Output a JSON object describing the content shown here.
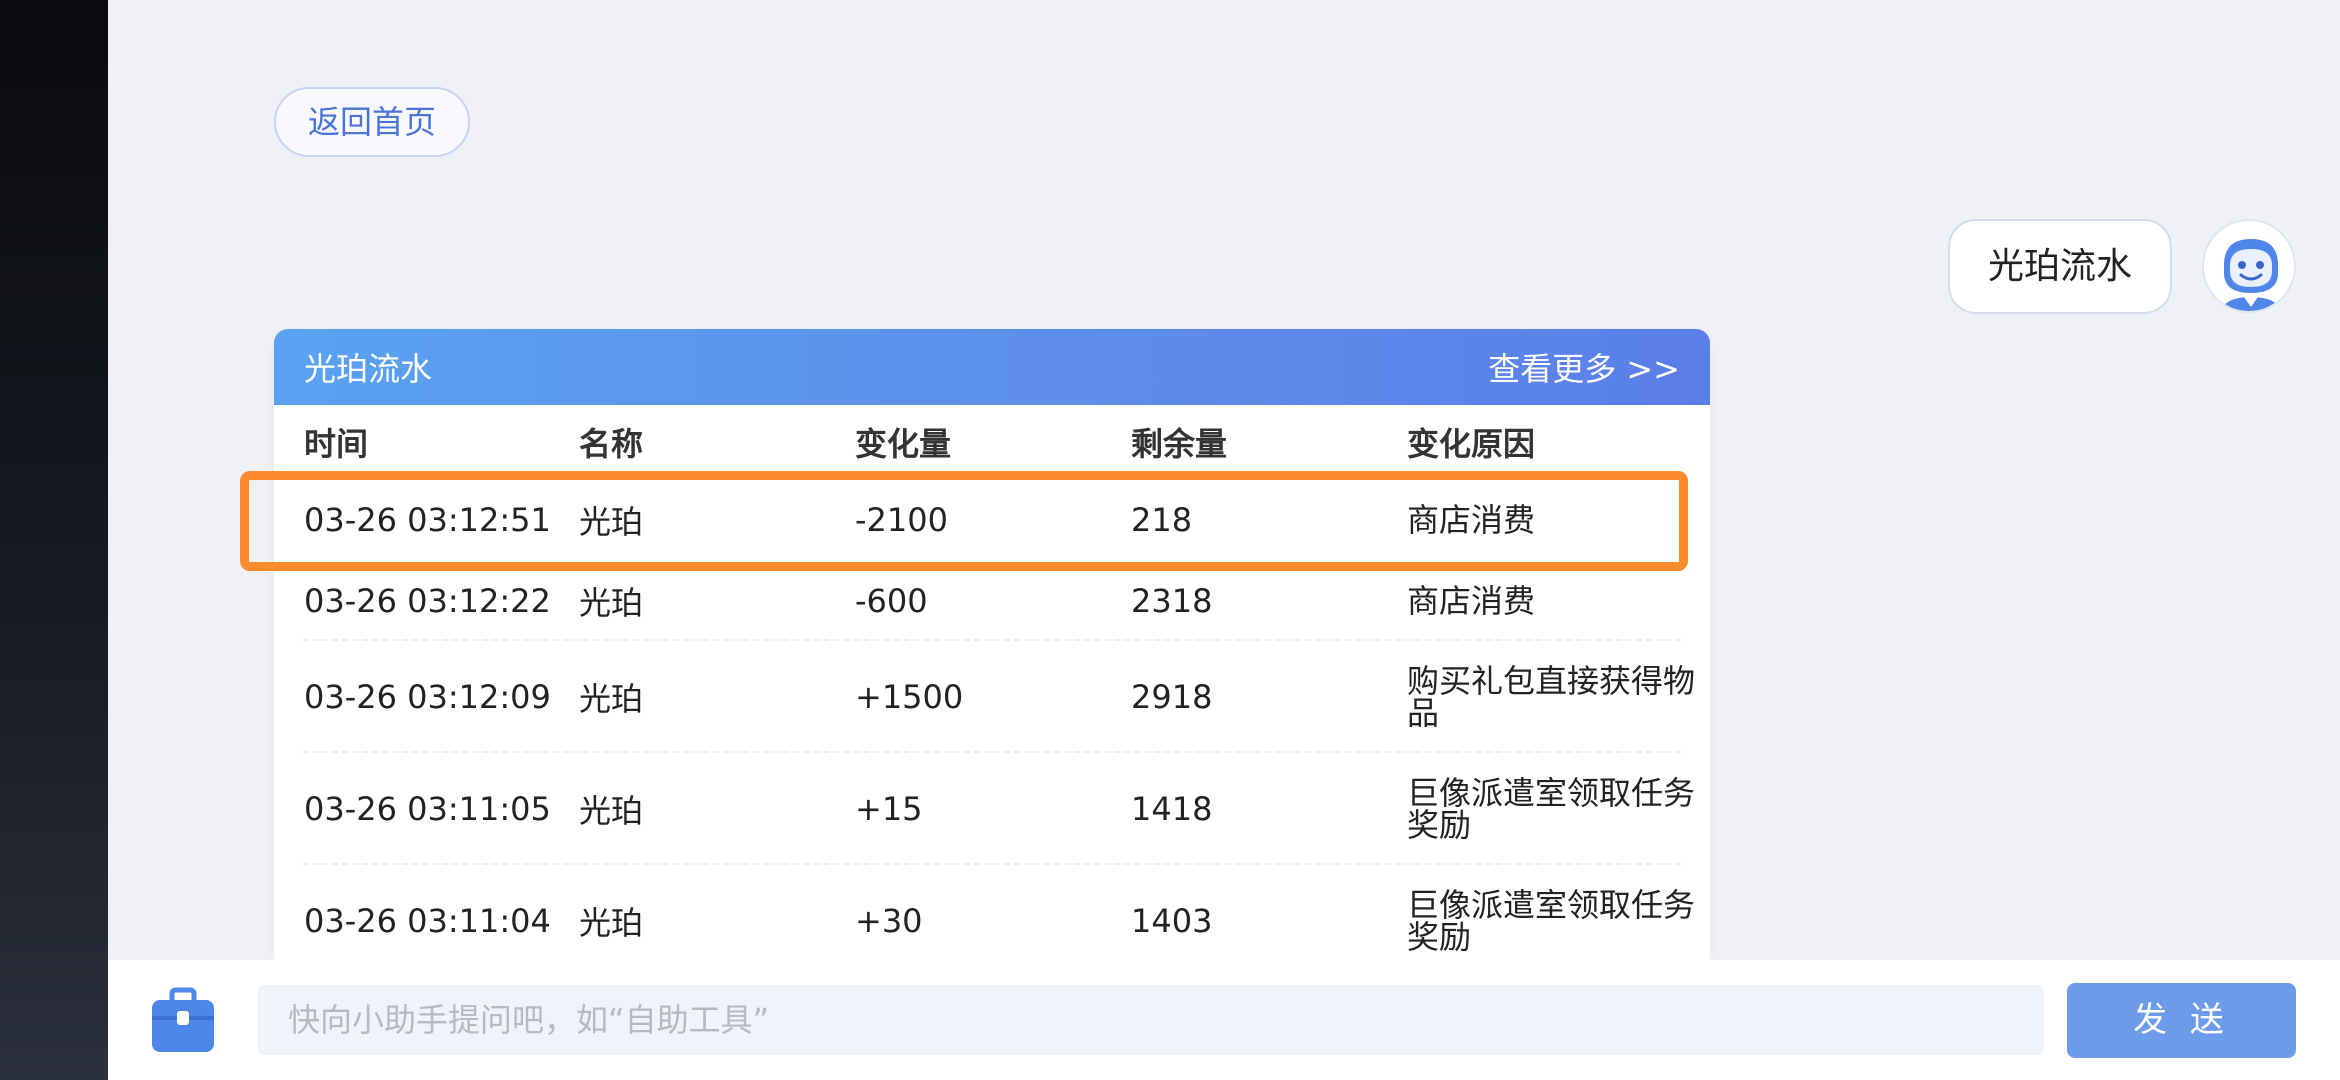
{
  "nav": {
    "home_label": "返回首页"
  },
  "chat": {
    "user_message": "光珀流水"
  },
  "card": {
    "title": "光珀流水",
    "more_label": "查看更多 >>",
    "columns": [
      "时间",
      "名称",
      "变化量",
      "剩余量",
      "变化原因"
    ],
    "rows": [
      {
        "time": "03-26 03:12:51",
        "name": "光珀",
        "change": "-2100",
        "remaining": "218",
        "reason": "商店消费"
      },
      {
        "time": "03-26 03:12:22",
        "name": "光珀",
        "change": "-600",
        "remaining": "2318",
        "reason": "商店消费"
      },
      {
        "time": "03-26 03:12:09",
        "name": "光珀",
        "change": "+1500",
        "remaining": "2918",
        "reason": "购买礼包直接获得物品"
      },
      {
        "time": "03-26 03:11:05",
        "name": "光珀",
        "change": "+15",
        "remaining": "1418",
        "reason": "巨像派遣室领取任务奖励"
      },
      {
        "time": "03-26 03:11:04",
        "name": "光珀",
        "change": "+30",
        "remaining": "1403",
        "reason": "巨像派遣室领取任务奖励"
      }
    ]
  },
  "input": {
    "placeholder": "快向小助手提问吧，如“自助工具”",
    "value": ""
  },
  "send_label": "发 送",
  "colors": {
    "accent": "#5d8eea",
    "highlight": "#fd8a2c",
    "send_button": "#6c9bea",
    "background": "#eff1f7"
  },
  "icons": {
    "toolbox": "toolbox-icon",
    "avatar": "assistant-avatar-icon"
  }
}
